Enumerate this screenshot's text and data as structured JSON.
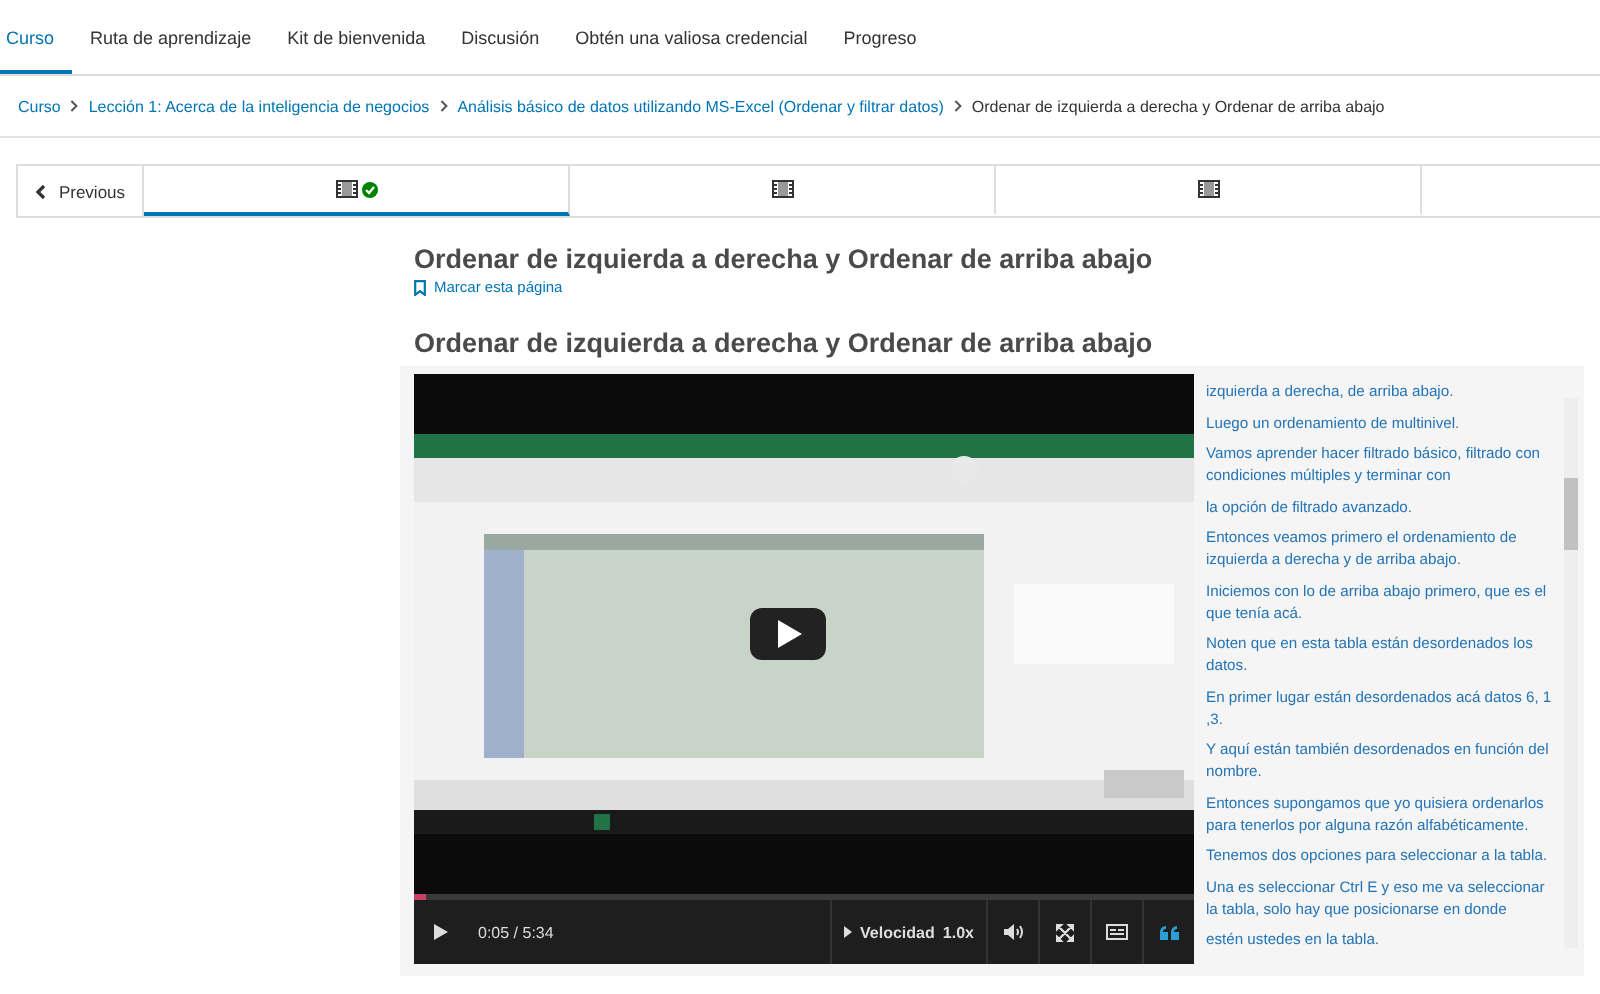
{
  "course_tabs": [
    {
      "label": "Curso",
      "selected": true
    },
    {
      "label": "Ruta de aprendizaje",
      "selected": false
    },
    {
      "label": "Kit de bienvenida",
      "selected": false
    },
    {
      "label": "Discusión",
      "selected": false
    },
    {
      "label": "Obtén una valiosa credencial",
      "selected": false
    },
    {
      "label": "Progreso",
      "selected": false
    }
  ],
  "breadcrumbs": [
    {
      "label": "Curso",
      "kind": "link"
    },
    {
      "label": "Lección 1: Acerca de la inteligencia de negocios",
      "kind": "link"
    },
    {
      "label": "Análisis básico de datos utilizando MS-Excel (Ordenar y filtrar datos)",
      "kind": "link"
    },
    {
      "label": "Ordenar de izquierda a derecha y Ordenar de arriba abajo",
      "kind": "current"
    }
  ],
  "sequence_nav": {
    "previous": "Previous",
    "units": [
      {
        "kind": "video",
        "completed": true,
        "selected": true
      },
      {
        "kind": "video",
        "completed": false,
        "selected": false
      },
      {
        "kind": "video",
        "completed": false,
        "selected": false
      }
    ]
  },
  "unit": {
    "title": "Ordenar de izquierda a derecha y Ordenar de arriba abajo",
    "bookmark": "Marcar esta página"
  },
  "video": {
    "title": "Ordenar de izquierda a derecha y Ordenar de arriba abajo",
    "progress": {
      "level": 0.015
    },
    "time": "0:05 / 5:34",
    "speed_label": "Velocidad",
    "speed": "1.0x",
    "transcript_on": true
  },
  "transcript": [
    "izquierda a derecha, de arriba abajo.",
    "Luego un ordenamiento de multinivel.",
    "Vamos aprender hacer filtrado básico, filtrado con condiciones múltiples y terminar con",
    "la opción de filtrado avanzado.",
    "Entonces veamos primero el ordenamiento de izquierda a derecha y de arriba abajo.",
    "Iniciemos con lo de arriba abajo primero, que es el que tenía acá.",
    "Noten que en esta tabla están desordenados los datos.",
    "En primer lugar están desordenados acá datos 6, 1 ,3.",
    "Y aquí están también desordenados en función del nombre.",
    "Entonces supongamos que yo quisiera ordenarlos para tenerlos por alguna razón alfabéticamente.",
    "Tenemos dos opciones para seleccionar a la tabla.",
    "Una es seleccionar Ctrl E y eso me va seleccionar la tabla, solo hay que posicionarse en donde",
    "estén ustedes en la tabla."
  ]
}
